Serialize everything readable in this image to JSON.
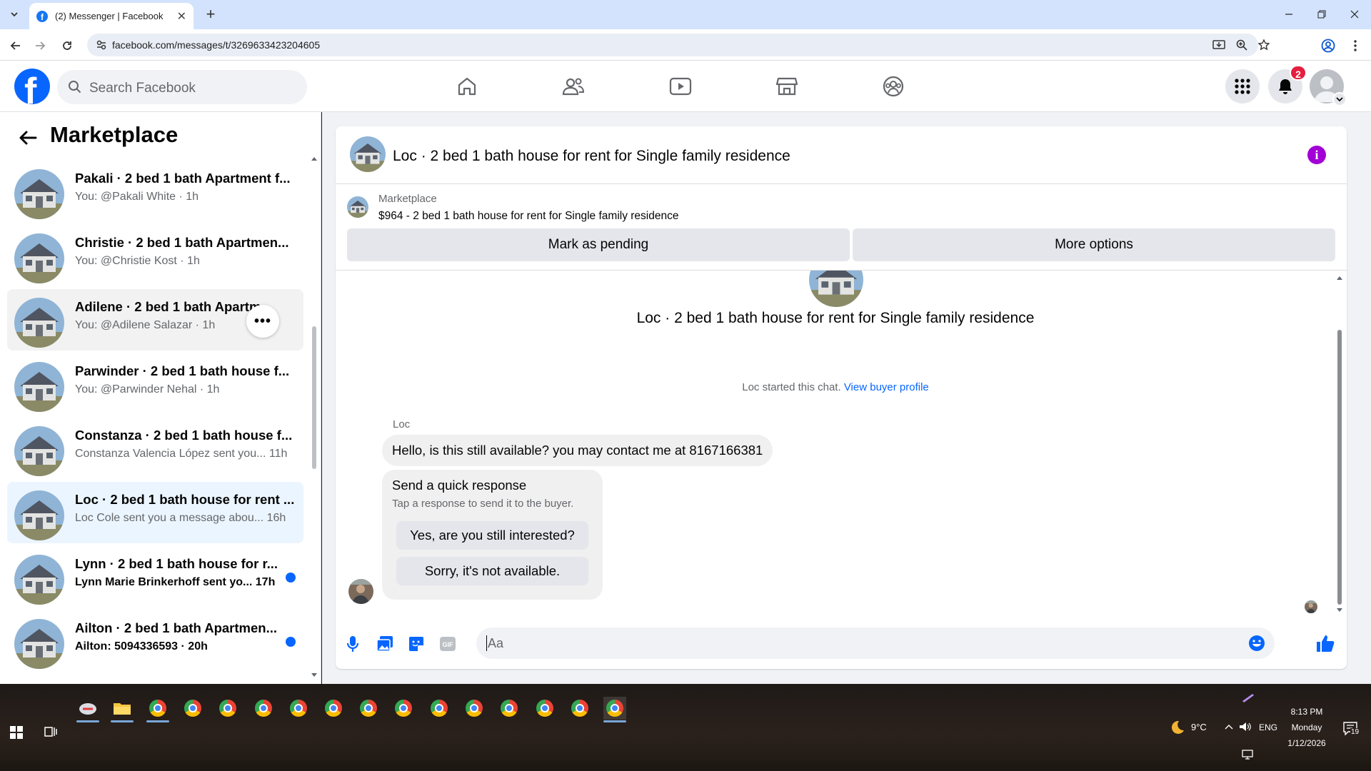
{
  "browser": {
    "tab_title": "(2) Messenger | Facebook",
    "url": "facebook.com/messages/t/3269633423204605"
  },
  "header": {
    "search_placeholder": "Search Facebook",
    "notification_count": "2"
  },
  "sidebar": {
    "title": "Marketplace",
    "chats": [
      {
        "name": "Pakali · 2 bed 1 bath Apartment f...",
        "sub": "You: @Pakali White · 1h",
        "unread": false
      },
      {
        "name": "Christie · 2 bed 1 bath Apartmen...",
        "sub": "You: @Christie Kost · 1h",
        "unread": false
      },
      {
        "name": "Adilene · 2 bed 1 bath Apartm...",
        "sub": "You: @Adilene Salazar · 1h",
        "unread": false
      },
      {
        "name": "Parwinder · 2 bed 1 bath house f...",
        "sub": "You: @Parwinder Nehal · 1h",
        "unread": false
      },
      {
        "name": "Constanza · 2 bed 1 bath house f...",
        "sub": "Constanza Valencia López sent you... 11h",
        "unread": false
      },
      {
        "name": "Loc · 2 bed 1 bath house for rent ...",
        "sub": "Loc Cole sent you a message abou... 16h",
        "unread": false
      },
      {
        "name": "Lynn · 2 bed 1 bath house for r...",
        "sub": "Lynn Marie Brinkerhoff sent yo...  17h",
        "unread": true
      },
      {
        "name": "Ailton · 2 bed 1 bath Apartmen...",
        "sub": "Ailton: 5094336593 · 20h",
        "unread": true
      }
    ]
  },
  "conversation": {
    "title": "Loc · 2 bed 1 bath house for rent for Single family residence",
    "marketplace_label": "Marketplace",
    "listing": "$964 - 2 bed 1 bath house for rent for Single family residence",
    "mark_pending": "Mark as pending",
    "more_options": "More options",
    "started_text": "Loc started this chat.",
    "view_profile": "View buyer profile",
    "sender": "Loc",
    "message": "Hello, is this still available? you may contact me at 8167166381",
    "quick_title": "Send a quick response",
    "quick_sub": "Tap a response to send it to the buyer.",
    "quick_1": "Yes, are you still interested?",
    "quick_2": "Sorry, it's not available.",
    "composer_placeholder": "Aa"
  },
  "taskbar": {
    "weather": "9°C",
    "lang": "ENG",
    "time": "8:13 PM",
    "day": "Monday",
    "date": "1/12/2026",
    "notif_count": "19"
  },
  "colors": {
    "fb_blue": "#0866ff",
    "unread_dot": "#0866ff",
    "info_purple": "#a200d6"
  }
}
